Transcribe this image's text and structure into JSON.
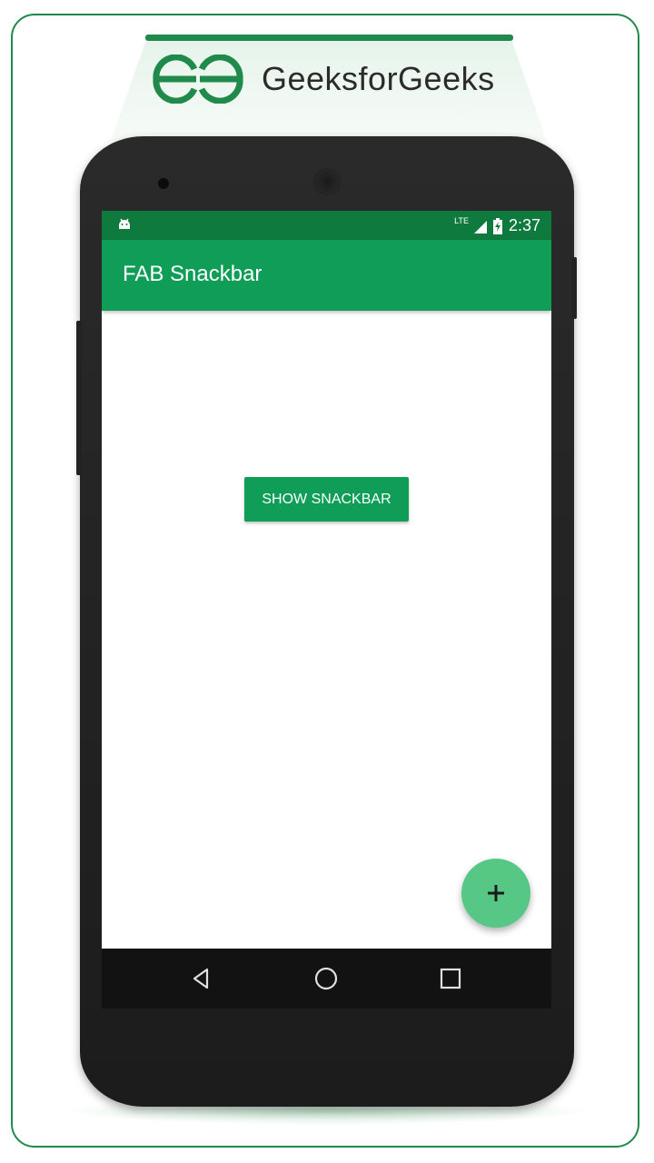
{
  "branding": {
    "logo_text": "GeeksforGeeks",
    "color": "#1f8a4c"
  },
  "statusbar": {
    "network": "LTE",
    "time": "2:37",
    "background": "#0f7a3e"
  },
  "app": {
    "title": "FAB Snackbar",
    "primary_color": "#0f9d58",
    "main_button_label": "SHOW SNACKBAR",
    "fab_icon": "plus-icon",
    "fab_color": "#57c785"
  },
  "navbar": {
    "icons": [
      "back-icon",
      "home-icon",
      "recents-icon"
    ]
  }
}
